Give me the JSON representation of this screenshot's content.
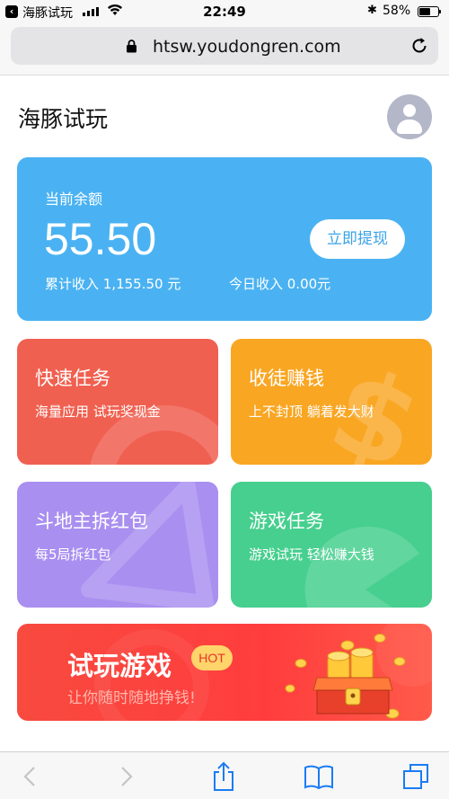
{
  "status_bar": {
    "back_app": "海豚试玩",
    "time": "22:49",
    "battery": "58%",
    "battery_level": 0.58
  },
  "browser": {
    "url": "htsw.youdongren.com"
  },
  "header": {
    "title": "海豚试玩"
  },
  "balance_card": {
    "label": "当前余额",
    "amount": "55.50",
    "withdraw_label": "立即提现",
    "total_income": "累计收入 1,155.50 元",
    "today_income": "今日收入 0.00元"
  },
  "tiles": [
    {
      "title": "快速任务",
      "subtitle": "海量应用 试玩奖现金"
    },
    {
      "title": "收徒赚钱",
      "subtitle": "上不封顶 躺着发大财"
    },
    {
      "title": "斗地主拆红包",
      "subtitle": "每5局拆红包"
    },
    {
      "title": "游戏任务",
      "subtitle": "游戏试玩 轻松赚大钱"
    }
  ],
  "banner": {
    "title": "试玩游戏",
    "badge": "HOT",
    "subtitle": "让你随时随地挣钱!"
  },
  "colors": {
    "balance": "#4ab2f2",
    "quick": "#f06050",
    "invite": "#f9a623",
    "ddz": "#a98ff0",
    "games": "#46cf8e",
    "banner": "#f84a3f"
  },
  "toolbar_icons": [
    "back-icon",
    "forward-icon",
    "share-icon",
    "bookmarks-icon",
    "tabs-icon"
  ]
}
